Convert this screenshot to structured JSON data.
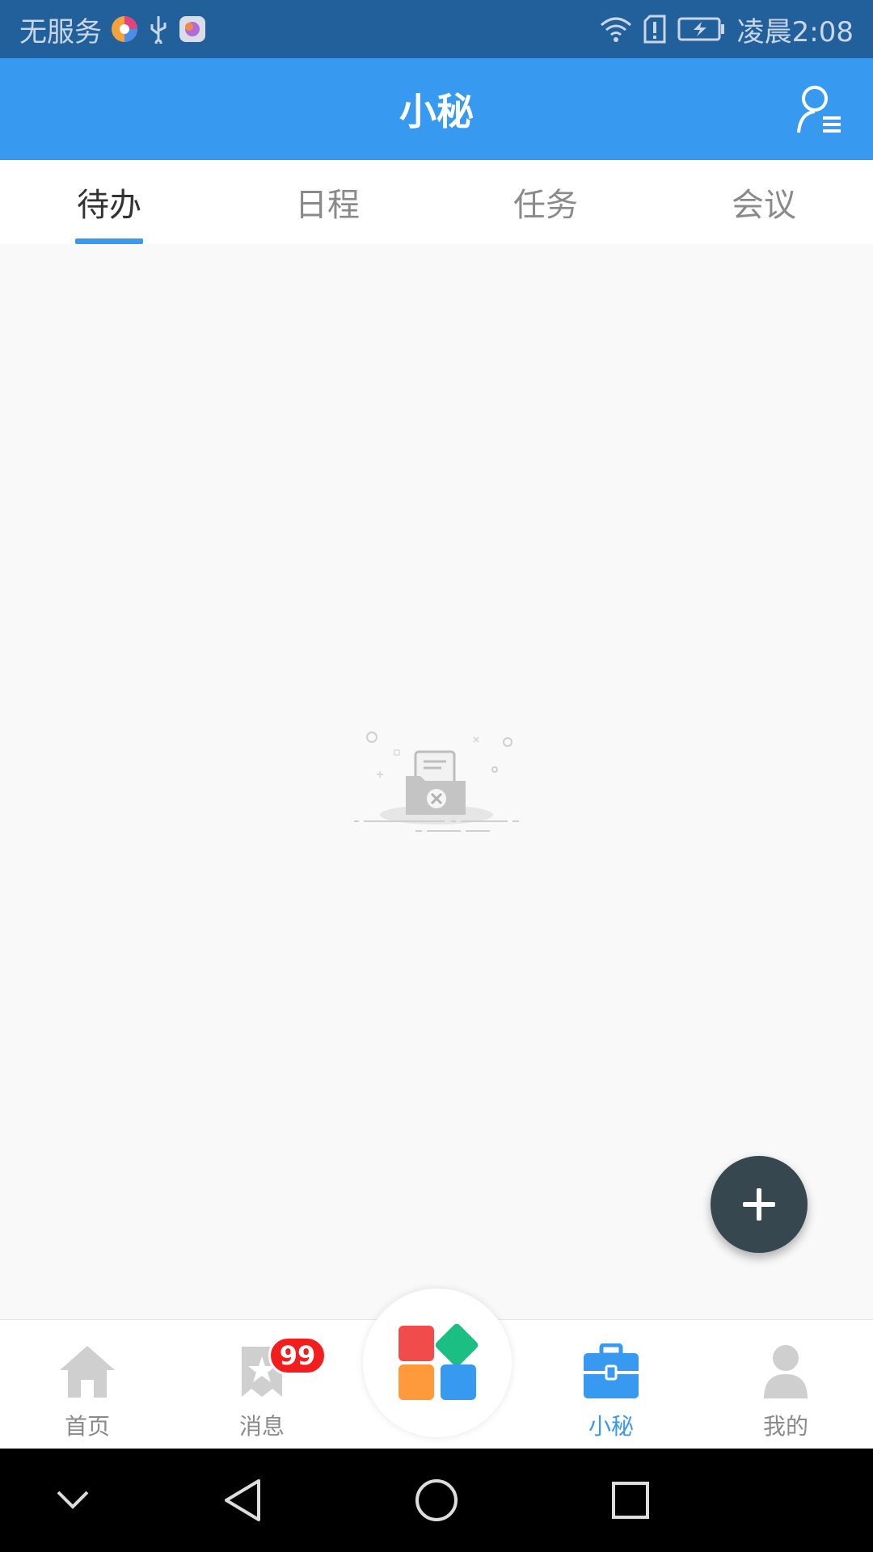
{
  "status_bar": {
    "carrier": "无服务",
    "time": "凌晨2:08",
    "icons": [
      "browser-app-icon",
      "usb-icon",
      "app-store-icon",
      "wifi-icon",
      "sim-alert-icon",
      "battery-charging-icon"
    ]
  },
  "app_bar": {
    "title": "小秘",
    "profile_icon": "user-list-icon"
  },
  "tabs": [
    {
      "label": "待办",
      "active": true
    },
    {
      "label": "日程",
      "active": false
    },
    {
      "label": "任务",
      "active": false
    },
    {
      "label": "会议",
      "active": false
    }
  ],
  "empty_state": {
    "icon": "empty-folder-icon"
  },
  "fab": {
    "icon": "plus-icon"
  },
  "bottom_nav": {
    "items": [
      {
        "label": "首页",
        "icon": "home-icon"
      },
      {
        "label": "消息",
        "icon": "message-icon",
        "badge": "99"
      },
      {
        "label": "小秘",
        "icon": "briefcase-icon",
        "active": true
      },
      {
        "label": "我的",
        "icon": "person-icon"
      }
    ],
    "center_icon": "apps-grid-icon"
  },
  "system_nav": {
    "icons": [
      "chevron-down-icon",
      "back-icon",
      "home-circle-icon",
      "recents-icon"
    ]
  },
  "colors": {
    "primary": "#3899f0",
    "status_bar": "#22609b",
    "fab": "#37474f",
    "badge": "#f21d1d",
    "tile_red": "#f24b4b",
    "tile_green": "#1bbf84",
    "tile_orange": "#ff9a3c",
    "tile_blue": "#3899f0"
  }
}
